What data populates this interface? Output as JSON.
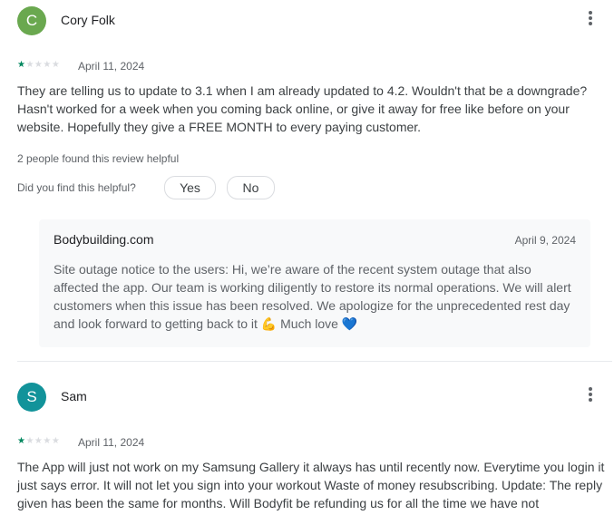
{
  "reviews": [
    {
      "avatar_letter": "C",
      "avatar_color": "#6aa84f",
      "name": "Cory Folk",
      "stars_on": "★",
      "stars_off": "★★★★",
      "rating": 1,
      "date": "April 11, 2024",
      "text": "They are telling us to update to 3.1 when I am already updated to 4.2. Wouldn't that be a downgrade? Hasn't worked for a week when you coming back online, or give it away for free like before on your website. Hopefully they give a FREE MONTH to every paying customer.",
      "helpful_count": "2 people found this review helpful",
      "helpful_question": "Did you find this helpful?",
      "yes_label": "Yes",
      "no_label": "No",
      "reply": {
        "developer": "Bodybuilding.com",
        "date": "April 9, 2024",
        "text": "Site outage notice to the users: Hi, we’re aware of the recent system outage that also affected the app. Our team is working diligently to restore its normal operations. We will alert customers when this issue has been resolved. We apologize for the unprecedented rest day and look forward to getting back to it 💪 Much love 💙"
      }
    },
    {
      "avatar_letter": "S",
      "avatar_color": "#12939a",
      "name": "Sam",
      "stars_on": "★",
      "stars_off": "★★★★",
      "rating": 1,
      "date": "April 11, 2024",
      "text": "The App will just not work on my Samsung Gallery it always has until recently now. Everytime you login it just says error. It will not let you sign into your workout Waste of money resubscribing. Update: The reply given has been the same for months. Will Bodyfit be refunding us for all the time we have not"
    }
  ],
  "icons": {
    "more": "more-vert-icon"
  }
}
